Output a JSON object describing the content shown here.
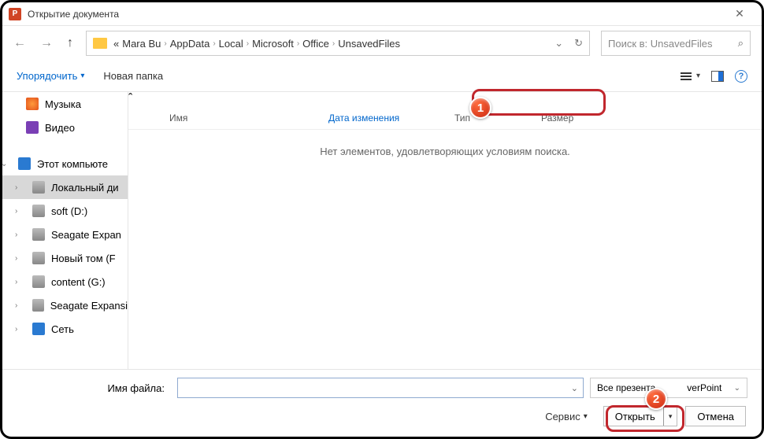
{
  "title": "Открытие документа",
  "close_glyph": "✕",
  "nav": {
    "back": "←",
    "fwd": "→",
    "up": "↑"
  },
  "path": {
    "prefix": "«",
    "crumbs": [
      "Mara Bu",
      "AppData",
      "Local",
      "Microsoft",
      "Office",
      "UnsavedFiles"
    ]
  },
  "path_controls": {
    "drop": "⌄",
    "refresh": "↻"
  },
  "search": {
    "placeholder": "Поиск в: UnsavedFiles",
    "icon": "⌕"
  },
  "toolbar": {
    "organize": "Упорядочить",
    "org_arrow": "▾",
    "new_folder": "Новая папка",
    "view_arrow": "▾",
    "help": "?"
  },
  "side": {
    "music": "Музыка",
    "video": "Видео",
    "this_pc": "Этот компьюте",
    "local_disk": "Локальный ди",
    "soft": "soft (D:)",
    "seagate1": "Seagate Expan",
    "newvol": "Новый том (F",
    "content": "content (G:)",
    "seagate2": "Seagate Expansi",
    "network": "Сеть"
  },
  "columns": {
    "name": "Имя",
    "date": "Дата изменения",
    "type": "Тип",
    "size": "Размер",
    "sort": "ˆ"
  },
  "empty": "Нет элементов, удовлетворяющих условиям поиска.",
  "bottom": {
    "filename_label": "Имя файла:",
    "filename_dd": "⌄",
    "filetype": "Все презента            verPoint",
    "filetype_dd": "⌄",
    "service": "Сервис",
    "service_dd": "▾",
    "open": "Открыть",
    "open_dd": "▾",
    "cancel": "Отмена"
  },
  "badges": {
    "b1": "1",
    "b2": "2"
  }
}
